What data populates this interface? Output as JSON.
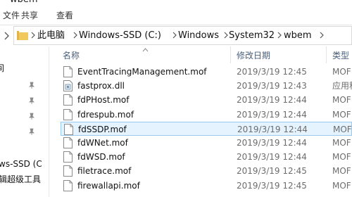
{
  "window": {
    "title": "wbem"
  },
  "ribbon": {
    "tabs": [
      "文件",
      "共享",
      "查看"
    ]
  },
  "address": {
    "crumbs": [
      "此电脑",
      "Windows-SSD (C:)",
      "Windows",
      "System32",
      "wbem"
    ]
  },
  "sidebar": {
    "items": [
      "间",
      "ws-SSD (C",
      "辑超级工具"
    ]
  },
  "columns": {
    "name": "名称",
    "date": "修改日期",
    "type": "类型"
  },
  "files": [
    {
      "name": "EventTracingManagement.mof",
      "date": "2019/3/19 12:45",
      "type": "MOF",
      "icon": "document-icon"
    },
    {
      "name": "fastprox.dll",
      "date": "2019/3/19 12:43",
      "type": "应用程",
      "icon": "dll-icon"
    },
    {
      "name": "fdPHost.mof",
      "date": "2019/3/19 12:44",
      "type": "MOF",
      "icon": "document-icon"
    },
    {
      "name": "fdrespub.mof",
      "date": "2019/3/19 12:44",
      "type": "MOF",
      "icon": "document-icon"
    },
    {
      "name": "fdSSDP.mof",
      "date": "2019/3/19 12:44",
      "type": "MOF",
      "icon": "document-icon"
    },
    {
      "name": "fdWNet.mof",
      "date": "2019/3/19 12:44",
      "type": "MOF",
      "icon": "document-icon"
    },
    {
      "name": "fdWSD.mof",
      "date": "2019/3/19 12:44",
      "type": "MOF",
      "icon": "document-icon"
    },
    {
      "name": "filetrace.mof",
      "date": "2019/3/19 12:45",
      "type": "MOF",
      "icon": "document-icon"
    },
    {
      "name": "firewallapi.mof",
      "date": "2019/3/19 12:45",
      "type": "MOF",
      "icon": "document-icon"
    }
  ],
  "selected_file": "fdSSDP.mof"
}
